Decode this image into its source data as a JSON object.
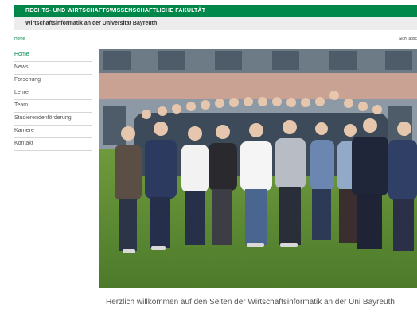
{
  "header": {
    "faculty_title": "RECHTS- UND WIRTSCHAFTSWISSENSCHAFTLICHE FAKULTÄT",
    "chair_title": "Wirtschaftsinformatik an der Universität Bayreuth"
  },
  "breadcrumb": {
    "home": "Home",
    "right_link": "Sicht absc"
  },
  "nav": {
    "items": [
      {
        "label": "Home",
        "active": true
      },
      {
        "label": "News"
      },
      {
        "label": "Forschung"
      },
      {
        "label": "Lehre"
      },
      {
        "label": "Team"
      },
      {
        "label": "Studierendenförderung"
      },
      {
        "label": "Karriere"
      },
      {
        "label": "Kontakt"
      }
    ]
  },
  "main": {
    "photo_icon": "team-photo",
    "welcome_text": "Herzlich willkommen auf den Seiten der Wirtschaftsinformatik an der Uni Bayreuth"
  },
  "colors": {
    "brand_green": "#00874a",
    "header_gray": "#ececec"
  }
}
